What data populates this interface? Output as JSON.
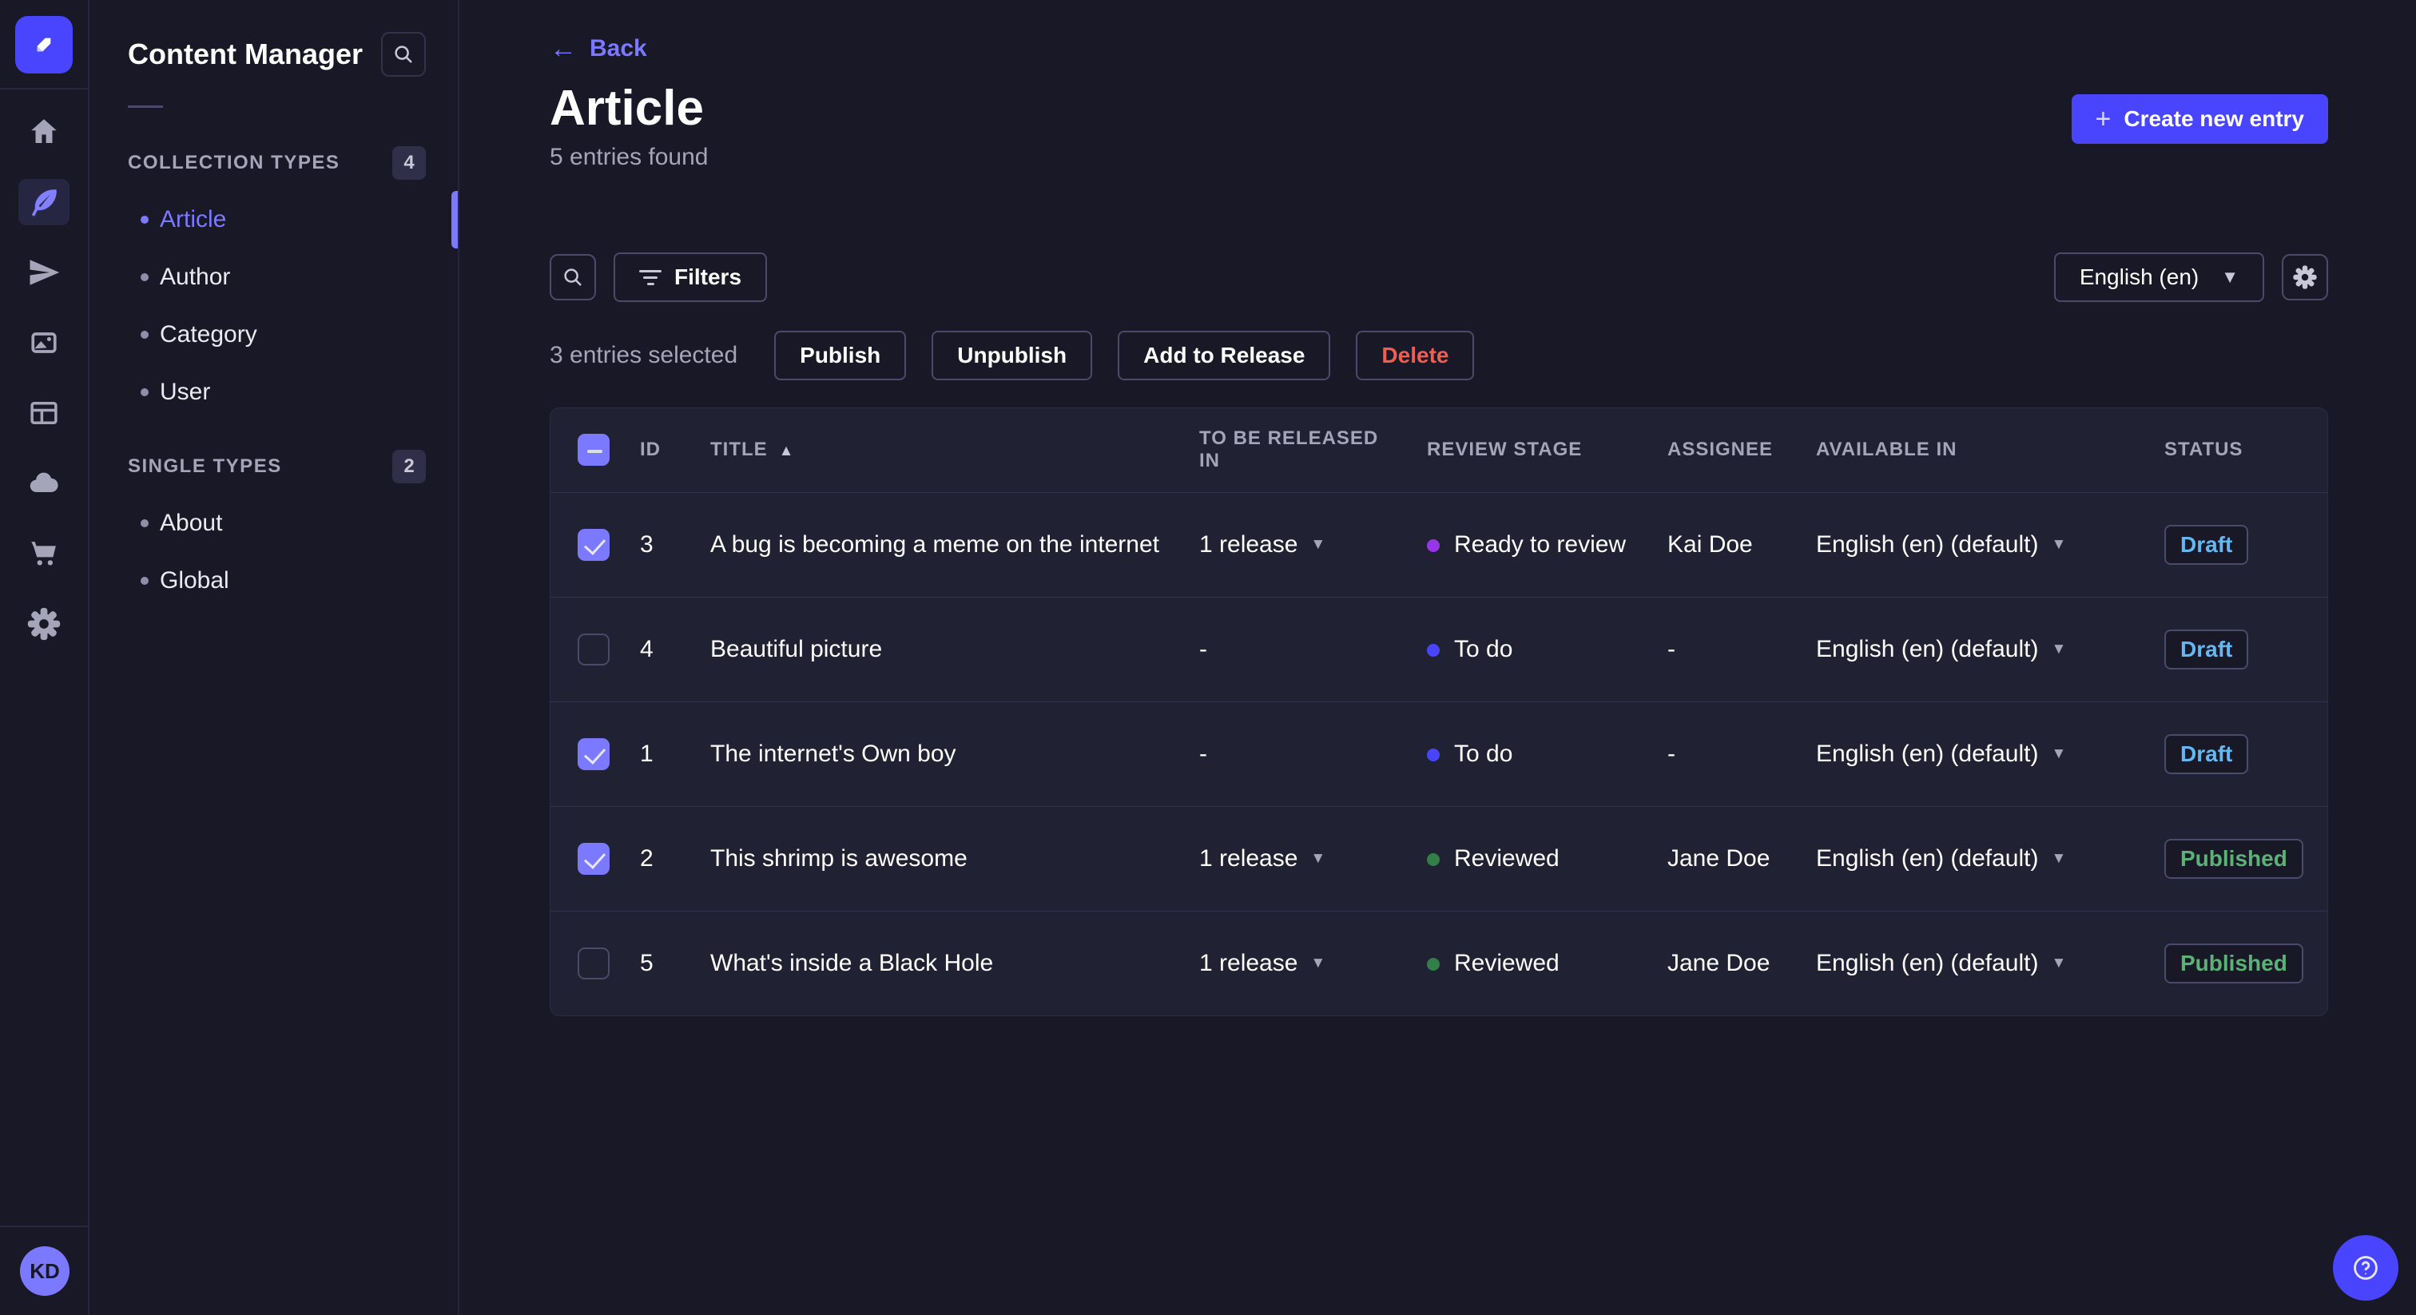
{
  "nav_rail": {
    "icons": [
      "home-icon",
      "feather-content-icon",
      "paper-plane-icon",
      "media-images-icon",
      "layout-builder-icon",
      "cloud-icon",
      "cart-icon",
      "gear-icon"
    ],
    "active_icon": "feather-content-icon",
    "avatar_initials": "KD"
  },
  "sidebar": {
    "title": "Content Manager",
    "sections": [
      {
        "label": "COLLECTION TYPES",
        "count": "4",
        "items": [
          {
            "label": "Article",
            "active": true
          },
          {
            "label": "Author"
          },
          {
            "label": "Category"
          },
          {
            "label": "User"
          }
        ]
      },
      {
        "label": "SINGLE TYPES",
        "count": "2",
        "items": [
          {
            "label": "About"
          },
          {
            "label": "Global"
          }
        ]
      }
    ]
  },
  "header": {
    "back_label": "Back",
    "title": "Article",
    "subtitle": "5 entries found",
    "create_button": "Create new entry"
  },
  "toolbar": {
    "filters_label": "Filters",
    "locale_selected": "English (en)"
  },
  "selection": {
    "selected_text": "3 entries selected",
    "actions": {
      "publish": "Publish",
      "unpublish": "Unpublish",
      "add_to_release": "Add to Release",
      "delete": "Delete"
    }
  },
  "table": {
    "columns": [
      "ID",
      "TITLE",
      "TO BE RELEASED IN",
      "REVIEW STAGE",
      "ASSIGNEE",
      "AVAILABLE IN",
      "STATUS"
    ],
    "sort": {
      "column": "TITLE",
      "direction": "asc"
    },
    "rows": [
      {
        "checked": true,
        "id": "3",
        "title": "A bug is becoming a meme on the internet",
        "released_in": "1 release",
        "review_stage": "Ready to review",
        "stage_color": "#9736e8",
        "assignee": "Kai Doe",
        "available_in": "English (en) (default)",
        "status": "Draft"
      },
      {
        "checked": false,
        "id": "4",
        "title": "Beautiful picture",
        "released_in": "-",
        "review_stage": "To do",
        "stage_color": "#4945ff",
        "assignee": "-",
        "available_in": "English (en) (default)",
        "status": "Draft"
      },
      {
        "checked": true,
        "id": "1",
        "title": "The internet's Own boy",
        "released_in": "-",
        "review_stage": "To do",
        "stage_color": "#4945ff",
        "assignee": "-",
        "available_in": "English (en) (default)",
        "status": "Draft"
      },
      {
        "checked": true,
        "id": "2",
        "title": "This shrimp is awesome",
        "released_in": "1 release",
        "review_stage": "Reviewed",
        "stage_color": "#328048",
        "assignee": "Jane Doe",
        "available_in": "English (en) (default)",
        "status": "Published"
      },
      {
        "checked": false,
        "id": "5",
        "title": "What's inside a Black Hole",
        "released_in": "1 release",
        "review_stage": "Reviewed",
        "stage_color": "#328048",
        "assignee": "Jane Doe",
        "available_in": "English (en) (default)",
        "status": "Published"
      }
    ]
  },
  "colors": {
    "accent_primary": "#4945ff",
    "accent_light": "#7b79ff",
    "draft": "#66b7f1",
    "published": "#5cb176",
    "danger": "#ee5e52",
    "page_bg": "#181826",
    "card_bg": "#212134"
  }
}
